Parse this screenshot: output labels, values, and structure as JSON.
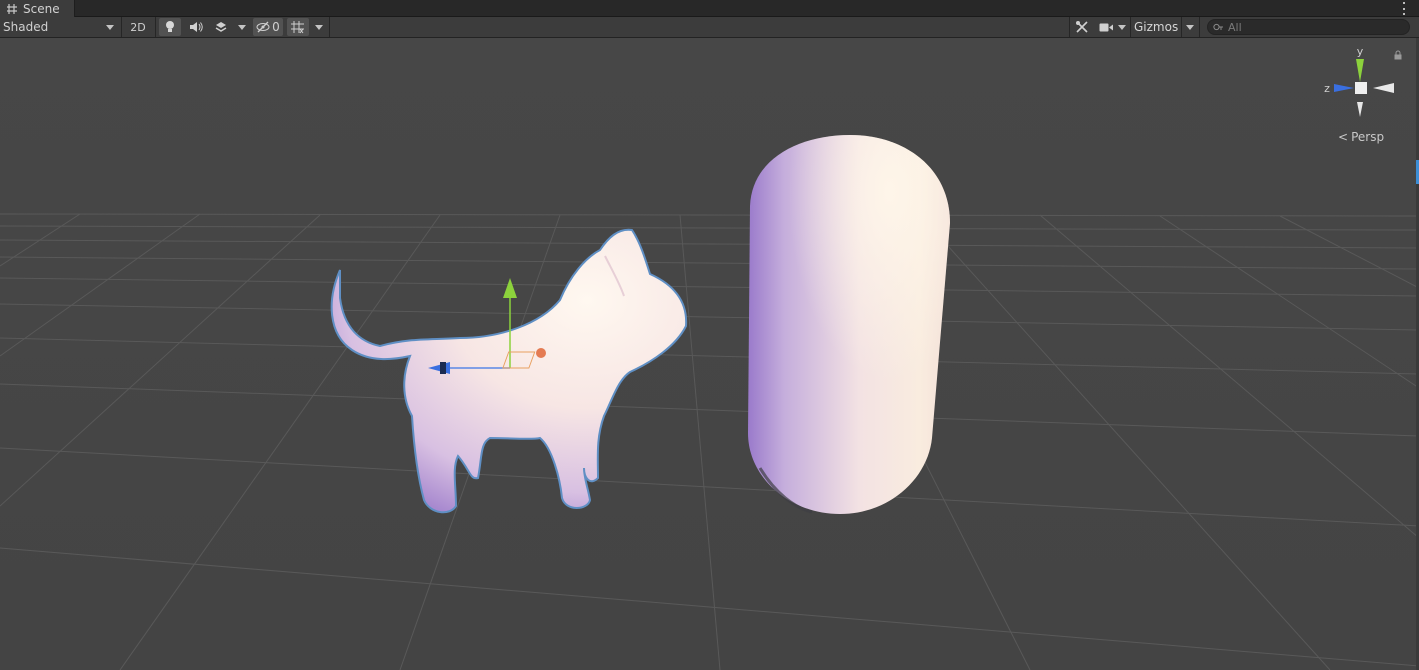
{
  "tab": {
    "title": "Scene",
    "icon": "hash-grid-icon"
  },
  "toolbar": {
    "draw_mode": "Shaded",
    "mode_2d": "2D",
    "lighting_icon": "lightbulb-icon",
    "audio_icon": "speaker-icon",
    "effects_icon": "effects-stack-icon",
    "hidden_count": "0",
    "hidden_icon": "eye-slash-icon",
    "grid_icon": "grid-snap-icon",
    "tools_icon": "crossed-tools-icon",
    "camera_icon": "camera-icon",
    "gizmos_label": "Gizmos",
    "search_placeholder": "All"
  },
  "viewport": {
    "projection_label": "Persp",
    "axis_y": "y",
    "axis_z": "z",
    "colors": {
      "background": "#464646",
      "grid": "#5a5a5a",
      "y_axis": "#8cd23c",
      "z_axis": "#3a6fe0",
      "x_axis": "#e0e0e0",
      "selection_outline": "#5f8fc4"
    },
    "objects": [
      "cat",
      "capsule"
    ]
  }
}
